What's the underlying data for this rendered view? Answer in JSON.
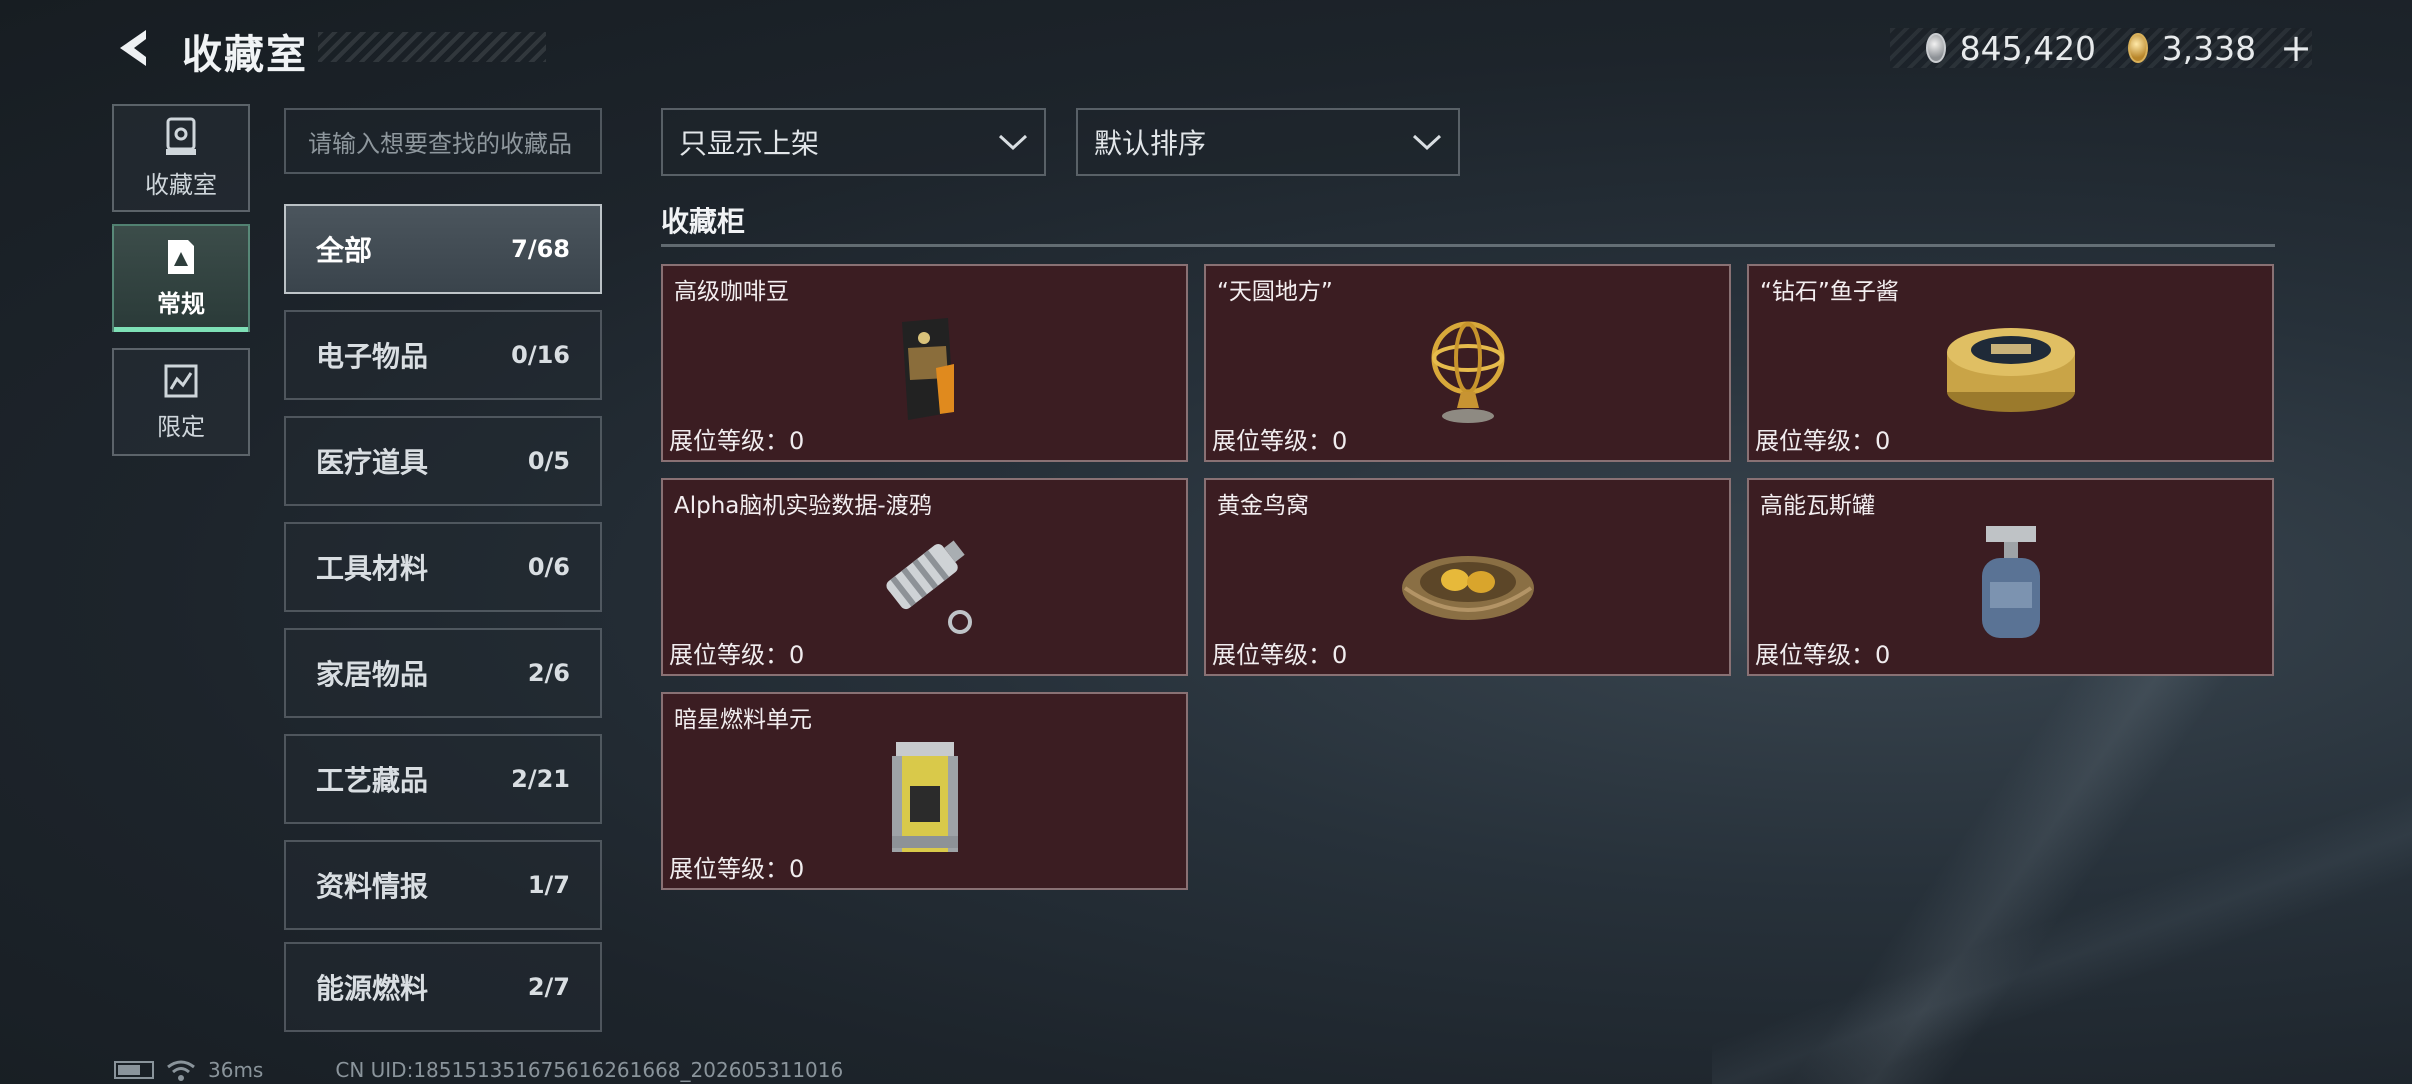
{
  "header": {
    "title": "收藏室",
    "currency": [
      {
        "icon": "silver-coin-icon",
        "value": "845,420"
      },
      {
        "icon": "gold-coin-icon",
        "value": "3,338"
      }
    ],
    "add_label": "+"
  },
  "rail": [
    {
      "label": "收藏室",
      "icon": "display-case-icon"
    },
    {
      "label": "常规",
      "icon": "regular-collection-icon",
      "active": true
    },
    {
      "label": "限定",
      "icon": "limited-collection-icon"
    }
  ],
  "search": {
    "placeholder": "请输入想要查找的收藏品"
  },
  "categories": [
    {
      "name": "全部",
      "count": "7/68",
      "active": true
    },
    {
      "name": "电子物品",
      "count": "0/16"
    },
    {
      "name": "医疗道具",
      "count": "0/5"
    },
    {
      "name": "工具材料",
      "count": "0/6"
    },
    {
      "name": "家居物品",
      "count": "2/6"
    },
    {
      "name": "工艺藏品",
      "count": "2/21"
    },
    {
      "name": "资料情报",
      "count": "1/7"
    },
    {
      "name": "能源燃料",
      "count": "2/7"
    }
  ],
  "filters": {
    "show_filter": "只显示上架",
    "sort": "默认排序"
  },
  "section": {
    "title": "收藏柜"
  },
  "items": [
    {
      "name": "高级咖啡豆",
      "level": "展位等级：0",
      "icon": "coffee-bag-icon"
    },
    {
      "name": "“天圆地方”",
      "level": "展位等级：0",
      "icon": "armillary-sphere-icon"
    },
    {
      "name": "“钻石”鱼子酱",
      "level": "展位等级：0",
      "icon": "caviar-tin-icon"
    },
    {
      "name": "Alpha脑机实验数据-渡鸦",
      "level": "展位等级：0",
      "icon": "data-canister-icon"
    },
    {
      "name": "黄金鸟窝",
      "level": "展位等级：0",
      "icon": "golden-nest-icon"
    },
    {
      "name": "高能瓦斯罐",
      "level": "展位等级：0",
      "icon": "gas-canister-icon"
    },
    {
      "name": "暗星燃料单元",
      "level": "展位等级：0",
      "icon": "fuel-cell-icon"
    }
  ],
  "status": {
    "ping": "36ms",
    "uid": "CN UID:1851513516756162616​68_202605311016"
  }
}
